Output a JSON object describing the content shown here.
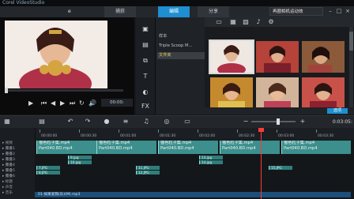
{
  "window": {
    "app_title": "Corel VideoStudio",
    "project_label": "e",
    "search_text": "再圈相机运动效",
    "min_icon": "minimize-icon",
    "max_icon": "maximize-icon",
    "close_icon": "close-icon"
  },
  "tabs": [
    {
      "label": "捕获"
    },
    {
      "label": "编辑"
    },
    {
      "label": "分享"
    }
  ],
  "preview": {
    "timecode": "00:00:",
    "controls": [
      "play",
      "prev",
      "rewind",
      "forward",
      "next",
      "repeat",
      "volume"
    ]
  },
  "library": {
    "items": [
      {
        "label": "样本"
      },
      {
        "label": "Triple Scoop M..."
      },
      {
        "label": "文件夹"
      }
    ],
    "thumbnails": 6,
    "options_label": "选项"
  },
  "timeline": {
    "timecode": "0:03:05:",
    "ruler_labels": [
      "00:00:00",
      "00:00:30",
      "00:01:00",
      "00:01:30",
      "00:02:00",
      "00:02:30",
      "00:03:00",
      "00:03:30"
    ],
    "track_labels": [
      "视频",
      "覆叠1",
      "覆叠2",
      "覆叠3",
      "覆叠4",
      "覆叠5",
      "覆叠6",
      "标题",
      "声音",
      "音乐"
    ],
    "video_clips": [
      {
        "name": "猫色粒子集.mp4",
        "sub": "Part040.BD.mp4"
      },
      {
        "name": "猫色粒子集.mp4",
        "sub": "Part040.BD.mp4"
      },
      {
        "name": "猫色粒子集.mp4",
        "sub": "Part040.BD.mp4"
      },
      {
        "name": "猫色粒子集.mp4",
        "sub": "Part040.BD.mp4"
      },
      {
        "name": "猫色粒子集.mp4",
        "sub": "Part040.BD.mp4"
      }
    ],
    "overlay_clips": [
      "9.jpg",
      "10.jpg",
      "13.jpg",
      "14.jpg",
      "7.JPG",
      "8.JPG",
      "11.JPG",
      "12.JPG",
      "15.JPG"
    ],
    "audio_clip": "01-如果爱我(乐)(M).mp3"
  },
  "colors": {
    "accent": "#1e8fd0",
    "clip": "#3c8f8c",
    "playhead": "#ff3a3a"
  }
}
